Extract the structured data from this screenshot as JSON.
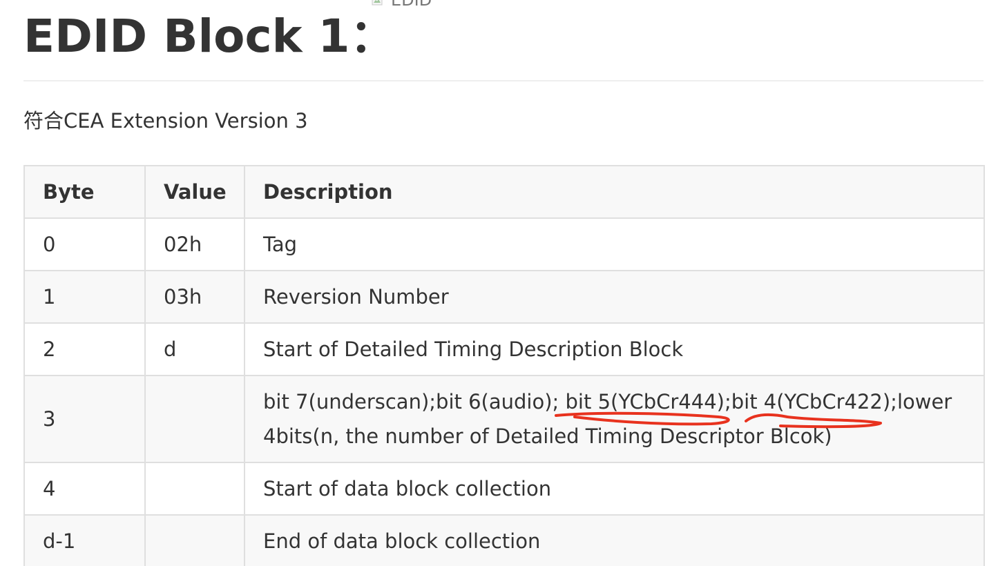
{
  "header": {
    "title": "EDID Block 1：",
    "broken_image_alt": "EDID"
  },
  "intro": "符合CEA Extension Version 3",
  "table": {
    "headers": [
      "Byte",
      "Value",
      "Description"
    ],
    "rows": [
      {
        "byte": "0",
        "value": "02h",
        "description": "Tag"
      },
      {
        "byte": "1",
        "value": "03h",
        "description": "Reversion Number"
      },
      {
        "byte": "2",
        "value": "d",
        "description": "Start of Detailed Timing Description Block"
      },
      {
        "byte": "3",
        "value": "",
        "description": "bit 7(underscan);bit 6(audio); bit 5(YCbCr444);bit 4(YCbCr422);lower 4bits(n, the number of Detailed Timing Descriptor Blcok)"
      },
      {
        "byte": "4",
        "value": "",
        "description": "Start of data block collection"
      },
      {
        "byte": "d-1",
        "value": "",
        "description": "End of data block collection"
      }
    ]
  },
  "annotation_color": "#e8321e",
  "colors": {
    "text": "#333333",
    "border": "#dfdfdf",
    "header_bg": "#f8f8f8",
    "rule": "#eeeeee"
  }
}
